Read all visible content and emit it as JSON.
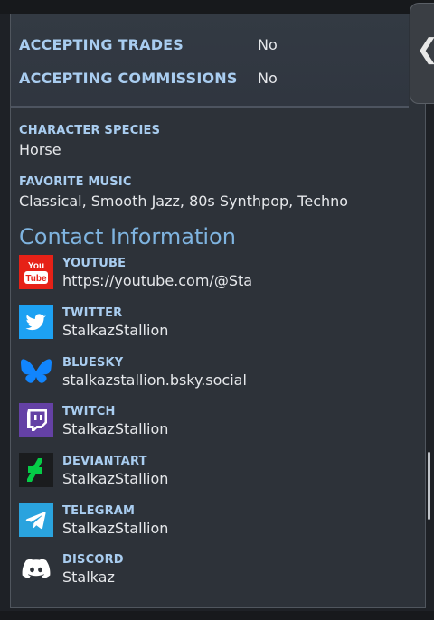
{
  "preferences": [
    {
      "label": "ACCEPTING TRADES",
      "value": "No"
    },
    {
      "label": "ACCEPTING COMMISSIONS",
      "value": "No"
    }
  ],
  "fields": [
    {
      "label": "CHARACTER SPECIES",
      "value": "Horse"
    },
    {
      "label": "FAVORITE MUSIC",
      "value": "Classical, Smooth Jazz, 80s Synthpop, Techno"
    }
  ],
  "contact_title": "Contact Information",
  "contacts": [
    {
      "label": "YOUTUBE",
      "value": "https://youtube.com/@Sta",
      "icon": "youtube-icon"
    },
    {
      "label": "TWITTER",
      "value": "StalkazStallion",
      "icon": "twitter-icon"
    },
    {
      "label": "BLUESKY",
      "value": "stalkazstallion.bsky.social",
      "icon": "bluesky-icon"
    },
    {
      "label": "TWITCH",
      "value": "StalkazStallion",
      "icon": "twitch-icon"
    },
    {
      "label": "DEVIANTART",
      "value": "StalkazStallion",
      "icon": "deviantart-icon"
    },
    {
      "label": "TELEGRAM",
      "value": "StalkazStallion",
      "icon": "telegram-icon"
    },
    {
      "label": "DISCORD",
      "value": "Stalkaz",
      "icon": "discord-icon"
    }
  ],
  "youtube_logo_text": "You Tube",
  "drawer_handle_glyph": "❮",
  "colors": {
    "label": "#a9cdf0",
    "section_title": "#7fb4e0",
    "panel_bg": "#2d3239",
    "youtube": "#e62117",
    "twitter": "#1da1f2",
    "bluesky": "#1185fe",
    "twitch": "#6441a5",
    "deviantart": "#05cc47",
    "telegram": "#2aa3de",
    "discord": "#ffffff"
  }
}
